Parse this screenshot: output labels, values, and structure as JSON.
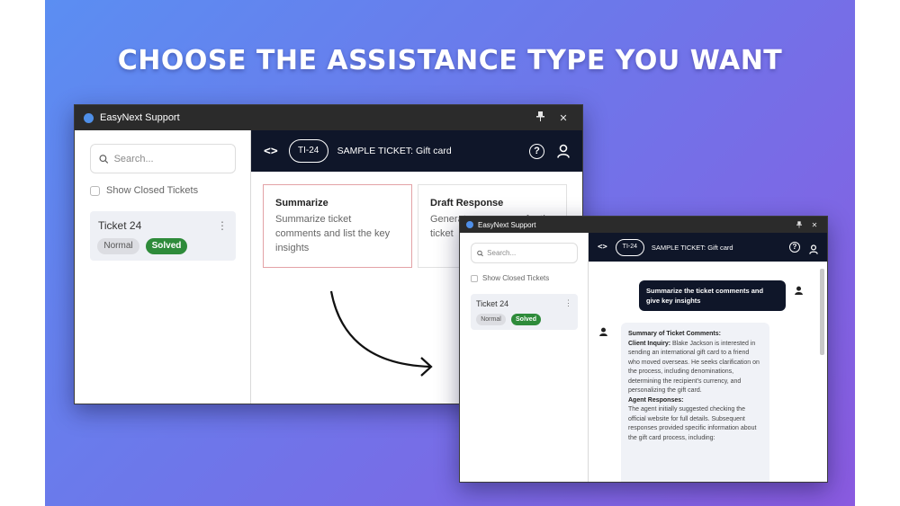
{
  "headline": "CHOOSE THE ASSISTANCE TYPE YOU WANT",
  "window_title": "EasyNext Support",
  "titlebar_buttons": {
    "pin": "📌",
    "close": "✕"
  },
  "search": {
    "placeholder": "Search..."
  },
  "show_closed_label": "Show Closed Tickets",
  "ticket": {
    "name": "Ticket 24",
    "priority": "Normal",
    "status": "Solved",
    "menu_icon": "⋮"
  },
  "topbar": {
    "code_icon": "<>",
    "ticket_id": "TI-24",
    "ticket_title": "SAMPLE TICKET: Gift card",
    "help_icon": "?"
  },
  "assistance_options": [
    {
      "title": "Summarize",
      "description": "Summarize ticket comments and list the key insights"
    },
    {
      "title": "Draft Response",
      "description": "Generate a response for the ticket"
    }
  ],
  "chat": {
    "user_message": "Summarize the ticket comments and give key insights",
    "summary_heading": "Summary of Ticket Comments:",
    "client_label": "Client Inquiry:",
    "client_text": "Blake Jackson is interested in sending an international gift card to a friend who moved overseas. He seeks clarification on the process, including denominations, determining the recipient's currency, and personalizing the gift card.",
    "agent_label": "Agent Responses:",
    "agent_text": "The agent initially suggested checking the official website for full details. Subsequent responses provided specific information about the gift card process, including:"
  },
  "colors": {
    "accent_dark": "#0f1629",
    "solved_green": "#2e8b3a",
    "selected_border": "#e3a2a6"
  }
}
